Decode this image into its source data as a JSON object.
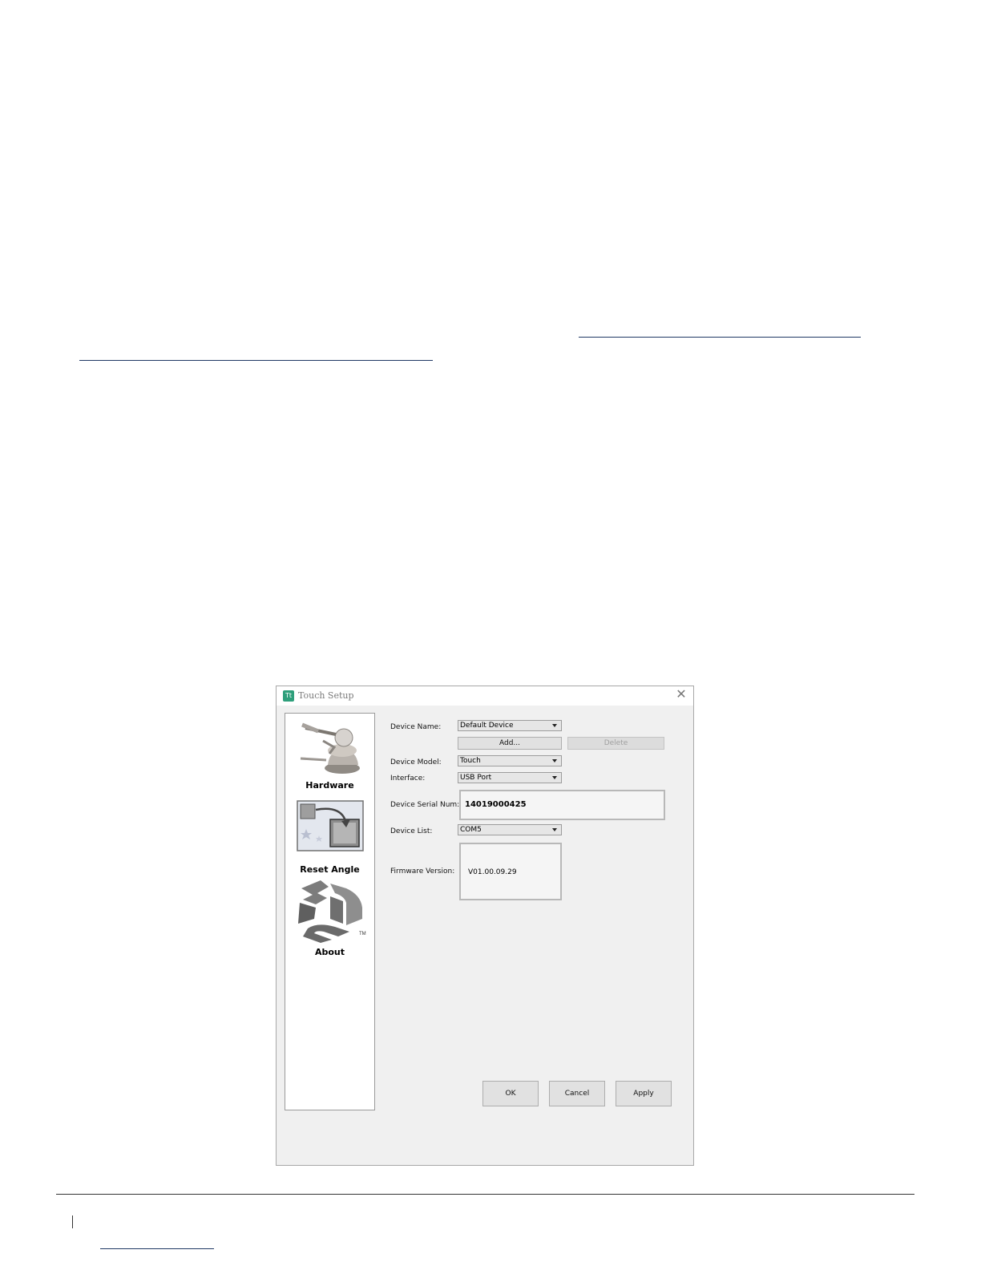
{
  "window": {
    "title": "Touch Setup",
    "icon_glyph": "Tt"
  },
  "nav": {
    "items": [
      {
        "label": "Hardware",
        "icon": "haptic-device-icon"
      },
      {
        "label": "Reset Angle",
        "icon": "reset-angle-icon"
      },
      {
        "label": "About",
        "icon": "3ds-logo-icon"
      }
    ],
    "trademark": "TM"
  },
  "form": {
    "device_name_label": "Device Name:",
    "device_name_value": "Default Device",
    "add_label": "Add...",
    "delete_label": "Delete",
    "device_model_label": "Device Model:",
    "device_model_value": "Touch",
    "interface_label": "Interface:",
    "interface_value": "USB Port",
    "serial_label": "Device Serial Num:",
    "serial_value": "14019000425",
    "device_list_label": "Device List:",
    "device_list_value": "COM5",
    "firmware_label": "Firmware Version:",
    "firmware_value": "V01.00.09.29"
  },
  "buttons": {
    "ok": "OK",
    "cancel": "Cancel",
    "apply": "Apply"
  }
}
